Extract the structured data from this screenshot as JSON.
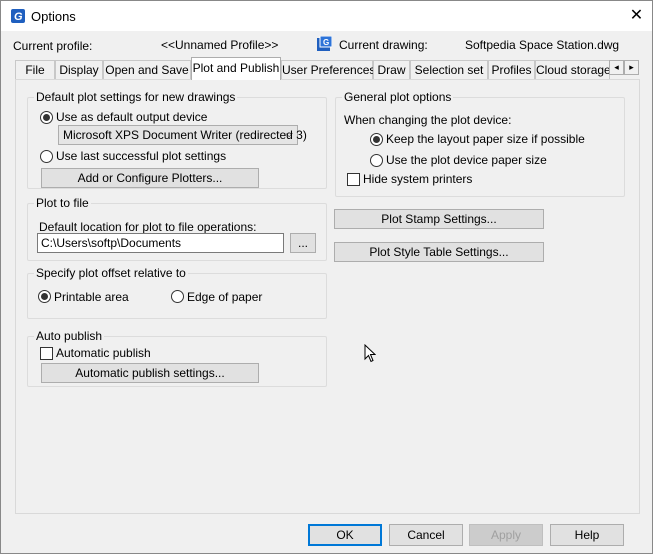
{
  "window": {
    "title": "Options",
    "close_glyph": "✕"
  },
  "profile": {
    "current_profile_label": "Current profile:",
    "current_profile_value": "<<Unnamed Profile>>",
    "current_drawing_label": "Current drawing:",
    "current_drawing_value": "Softpedia Space Station.dwg"
  },
  "tabs": [
    {
      "label": "File"
    },
    {
      "label": "Display"
    },
    {
      "label": "Open and Save"
    },
    {
      "label": "Plot and Publish"
    },
    {
      "label": "User Preferences"
    },
    {
      "label": "Draw"
    },
    {
      "label": "Selection set"
    },
    {
      "label": "Profiles"
    },
    {
      "label": "Cloud storage"
    }
  ],
  "tab_scroll": {
    "left": "◂",
    "right": "▸"
  },
  "default_plot": {
    "title": "Default plot settings for new drawings",
    "use_default_device": "Use as default output device",
    "device_value": "Microsoft XPS Document Writer (redirected 3)",
    "use_last": "Use last successful plot settings",
    "add_configure": "Add or Configure Plotters..."
  },
  "plot_to_file": {
    "title": "Plot to file",
    "location_label": "Default location for plot to file operations:",
    "location_value": "C:\\Users\\softp\\Documents",
    "browse": "..."
  },
  "plot_offset": {
    "title": "Specify plot offset relative to",
    "printable": "Printable area",
    "edge": "Edge of paper"
  },
  "auto_publish": {
    "title": "Auto publish",
    "automatic": "Automatic publish",
    "settings": "Automatic publish settings..."
  },
  "general": {
    "title": "General plot options",
    "when_changing": "When changing the plot device:",
    "keep_layout": "Keep the layout paper size if possible",
    "use_device": "Use the plot device paper size",
    "hide_printers": "Hide system printers"
  },
  "stamp_btn": "Plot Stamp Settings...",
  "style_btn": "Plot Style Table Settings...",
  "footer": {
    "ok": "OK",
    "cancel": "Cancel",
    "apply": "Apply",
    "help": "Help"
  }
}
